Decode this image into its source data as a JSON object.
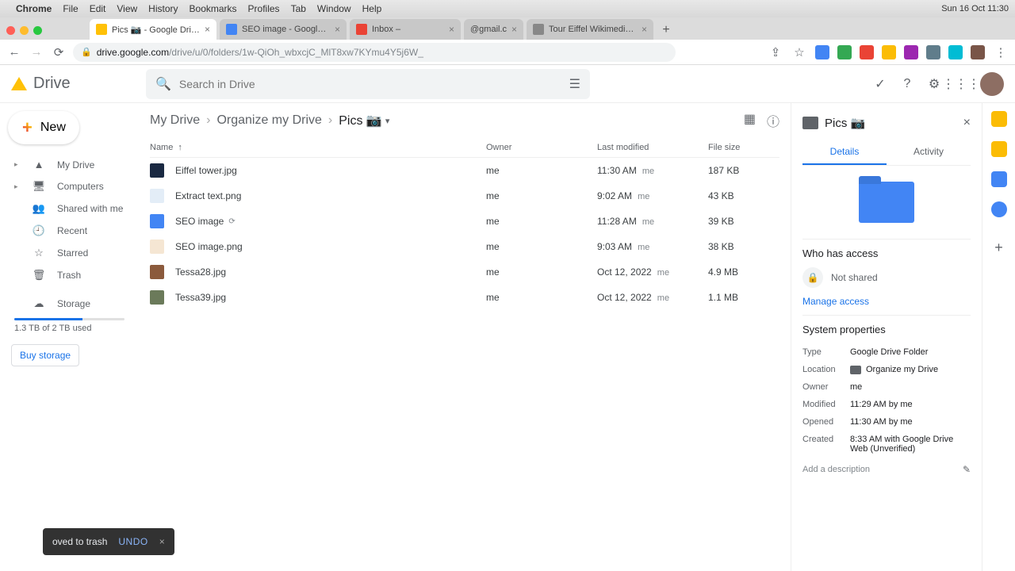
{
  "menubar": {
    "app": "Chrome",
    "items": [
      "File",
      "Edit",
      "View",
      "History",
      "Bookmarks",
      "Profiles",
      "Tab",
      "Window",
      "Help"
    ],
    "clock": "Sun 16 Oct 11:30"
  },
  "tabs": [
    {
      "title": "Pics 📷 - Google Drive",
      "active": true
    },
    {
      "title": "SEO image - Google Docs",
      "active": false
    },
    {
      "title": "Inbox –",
      "active": false
    },
    {
      "title": "@gmail.c",
      "active": false
    },
    {
      "title": "Tour Eiffel Wikimedia Comm",
      "active": false
    }
  ],
  "url": {
    "host": "drive.google.com",
    "path": "/drive/u/0/folders/1w-QiOh_wbxcjC_MlT8xw7KYmu4Y5j6W_"
  },
  "drive": {
    "name": "Drive",
    "search_placeholder": "Search in Drive"
  },
  "sidebar": {
    "new": "New",
    "items": [
      {
        "label": "My Drive",
        "icon": "▸"
      },
      {
        "label": "Computers",
        "icon": "▸"
      },
      {
        "label": "Shared with me",
        "icon": ""
      },
      {
        "label": "Recent",
        "icon": ""
      },
      {
        "label": "Starred",
        "icon": ""
      },
      {
        "label": "Trash",
        "icon": ""
      }
    ],
    "storage_label": "Storage",
    "storage_used": "1.3 TB of 2 TB used",
    "buy": "Buy storage"
  },
  "breadcrumb": [
    "My Drive",
    "Organize my Drive",
    "Pics 📷"
  ],
  "columns": {
    "name": "Name",
    "owner": "Owner",
    "modified": "Last modified",
    "size": "File size"
  },
  "files": [
    {
      "name": "Eiffel tower.jpg",
      "owner": "me",
      "modified": "11:30 AM",
      "mod_by": "me",
      "size": "187 KB",
      "thumb": "#1a2942"
    },
    {
      "name": "Extract text.png",
      "owner": "me",
      "modified": "9:02 AM",
      "mod_by": "me",
      "size": "43 KB",
      "thumb": "#e3edf7"
    },
    {
      "name": "SEO image",
      "owner": "me",
      "modified": "11:28 AM",
      "mod_by": "me",
      "size": "39 KB",
      "thumb": "#4285f4",
      "doc": true
    },
    {
      "name": "SEO image.png",
      "owner": "me",
      "modified": "9:03 AM",
      "mod_by": "me",
      "size": "38 KB",
      "thumb": "#f5e6d3"
    },
    {
      "name": "Tessa28.jpg",
      "owner": "me",
      "modified": "Oct 12, 2022",
      "mod_by": "me",
      "size": "4.9 MB",
      "thumb": "#8b5a3c"
    },
    {
      "name": "Tessa39.jpg",
      "owner": "me",
      "modified": "Oct 12, 2022",
      "mod_by": "me",
      "size": "1.1 MB",
      "thumb": "#6b7a5a"
    }
  ],
  "details": {
    "title": "Pics 📷",
    "tabs": {
      "details": "Details",
      "activity": "Activity"
    },
    "access_title": "Who has access",
    "not_shared": "Not shared",
    "manage": "Manage access",
    "sys_title": "System properties",
    "props": {
      "type_k": "Type",
      "type_v": "Google Drive Folder",
      "loc_k": "Location",
      "loc_v": "Organize my Drive",
      "owner_k": "Owner",
      "owner_v": "me",
      "mod_k": "Modified",
      "mod_v": "11:29 AM by me",
      "open_k": "Opened",
      "open_v": "11:30 AM by me",
      "created_k": "Created",
      "created_v": "8:33 AM with Google Drive Web (Unverified)"
    },
    "desc_placeholder": "Add a description"
  },
  "toast": {
    "text": "oved to trash",
    "undo": "UNDO"
  }
}
